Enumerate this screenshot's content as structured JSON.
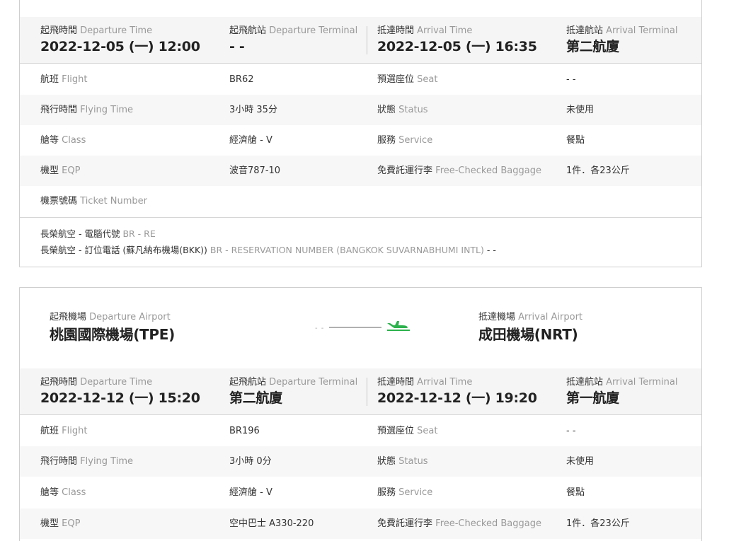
{
  "flight1": {
    "times": {
      "departure_time_label_zh": "起飛時間",
      "departure_time_label_en": "Departure Time",
      "departure_time": "2022-12-05 (一) 12:00",
      "departure_terminal_label_zh": "起飛航站",
      "departure_terminal_label_en": "Departure Terminal",
      "departure_terminal": "- -",
      "arrival_time_label_zh": "抵達時間",
      "arrival_time_label_en": "Arrival Time",
      "arrival_time": "2022-12-05 (一) 16:35",
      "arrival_terminal_label_zh": "抵達航站",
      "arrival_terminal_label_en": "Arrival Terminal",
      "arrival_terminal": "第二航廈"
    },
    "rows": [
      {
        "l_zh": "航班",
        "l_en": "Flight",
        "v": "BR62",
        "r_zh": "預選座位",
        "r_en": "Seat",
        "rv": "- -"
      },
      {
        "l_zh": "飛行時間",
        "l_en": "Flying Time",
        "v": "3小時 35分",
        "r_zh": "狀態",
        "r_en": "Status",
        "rv": "未使用"
      },
      {
        "l_zh": "艙等",
        "l_en": "Class",
        "v": "經濟艙 - V",
        "r_zh": "服務",
        "r_en": "Service",
        "rv": "餐點"
      },
      {
        "l_zh": "機型",
        "l_en": "EQP",
        "v": "波音787-10",
        "r_zh": "免費託運行李",
        "r_en": "Free-Checked Baggage",
        "rv": "1件．各23公斤"
      },
      {
        "l_zh": "機票號碼",
        "l_en": "Ticket Number",
        "v": "",
        "r_zh": "",
        "r_en": "",
        "rv": ""
      }
    ],
    "note": {
      "line1_zh": "長榮航空 - 電腦代號",
      "line1_en": "BR - RE",
      "line2_zh": "長榮航空 - 訂位電話 (蘇凡納布機場(BKK))",
      "line2_en": "BR - RESERVATION NUMBER (BANGKOK SUVARNABHUMI INTL)",
      "line2_value": "- -"
    }
  },
  "flight2": {
    "airports": {
      "departure_label_zh": "起飛機場",
      "departure_label_en": "Departure Airport",
      "departure": "桃園國際機場(TPE)",
      "arrival_label_zh": "抵達機場",
      "arrival_label_en": "Arrival Airport",
      "arrival": "成田機場(NRT)"
    },
    "times": {
      "departure_time_label_zh": "起飛時間",
      "departure_time_label_en": "Departure Time",
      "departure_time": "2022-12-12 (一) 15:20",
      "departure_terminal_label_zh": "起飛航站",
      "departure_terminal_label_en": "Departure Terminal",
      "departure_terminal": "第二航廈",
      "arrival_time_label_zh": "抵達時間",
      "arrival_time_label_en": "Arrival Time",
      "arrival_time": "2022-12-12 (一) 19:20",
      "arrival_terminal_label_zh": "抵達航站",
      "arrival_terminal_label_en": "Arrival Terminal",
      "arrival_terminal": "第一航廈"
    },
    "rows": [
      {
        "l_zh": "航班",
        "l_en": "Flight",
        "v": "BR196",
        "r_zh": "預選座位",
        "r_en": "Seat",
        "rv": "- -"
      },
      {
        "l_zh": "飛行時間",
        "l_en": "Flying Time",
        "v": "3小時 0分",
        "r_zh": "狀態",
        "r_en": "Status",
        "rv": "未使用"
      },
      {
        "l_zh": "艙等",
        "l_en": "Class",
        "v": "經濟艙 - V",
        "r_zh": "服務",
        "r_en": "Service",
        "rv": "餐點"
      },
      {
        "l_zh": "機型",
        "l_en": "EQP",
        "v": "空中巴士 A330-220",
        "r_zh": "免費託運行李",
        "r_en": "Free-Checked Baggage",
        "rv": "1件．各23公斤"
      }
    ]
  },
  "colors": {
    "accent_green": "#2bb24c",
    "muted_text": "#999999",
    "band_background": "#f5f5f5"
  },
  "icons": {
    "route": "airplane-landing-icon"
  }
}
